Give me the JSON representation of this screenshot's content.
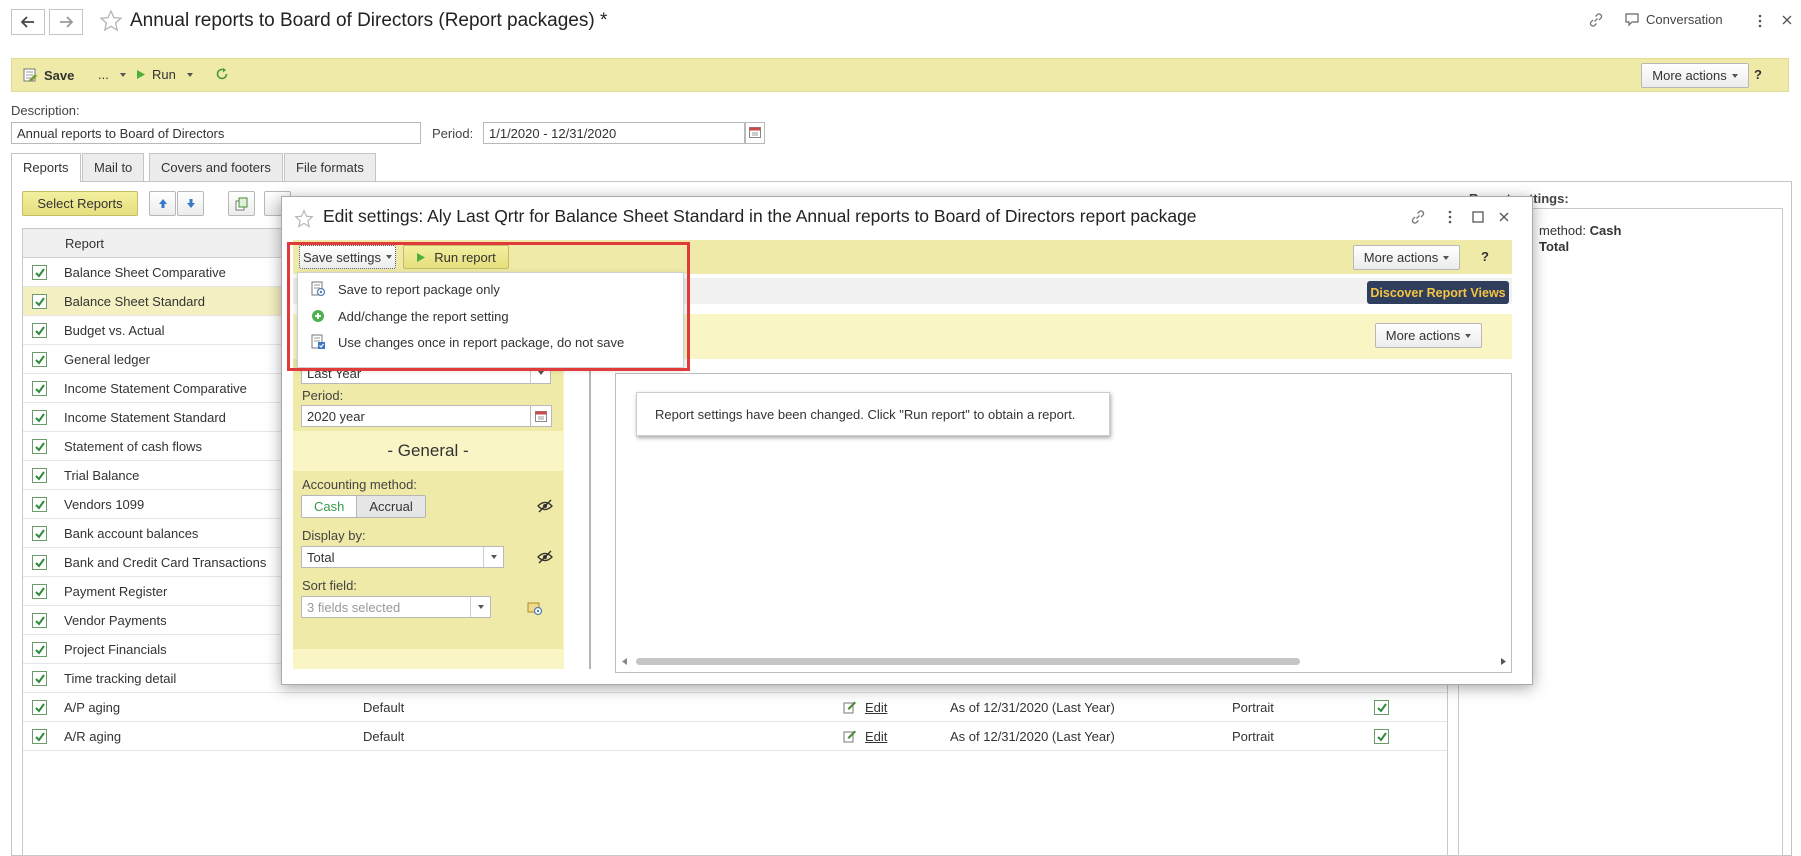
{
  "window": {
    "title": "Annual reports to Board of Directors (Report packages) *",
    "conversation_label": "Conversation"
  },
  "toolbar": {
    "save_label": "Save",
    "dots_label": "...",
    "run_label": "Run",
    "more_actions_label": "More actions",
    "help_label": "?"
  },
  "form": {
    "description_label": "Description:",
    "description_value": "Annual reports to Board of Directors",
    "period_label": "Period:",
    "period_value": "1/1/2020 - 12/31/2020"
  },
  "tabs": [
    {
      "label": "Reports",
      "active": true
    },
    {
      "label": "Mail to",
      "active": false
    },
    {
      "label": "Covers and footers",
      "active": false
    },
    {
      "label": "File formats",
      "active": false
    }
  ],
  "reports_panel": {
    "select_reports_label": "Select Reports",
    "column_report": "Report",
    "rows": [
      {
        "name": "Balance Sheet Comparative",
        "checked": true,
        "selected": false
      },
      {
        "name": "Balance Sheet Standard",
        "checked": true,
        "selected": true
      },
      {
        "name": "Budget vs. Actual",
        "checked": true,
        "selected": false
      },
      {
        "name": "General ledger",
        "checked": true,
        "selected": false
      },
      {
        "name": "Income Statement Comparative",
        "checked": true,
        "selected": false
      },
      {
        "name": "Income Statement Standard",
        "checked": true,
        "selected": false
      },
      {
        "name": "Statement of cash flows",
        "checked": true,
        "selected": false
      },
      {
        "name": "Trial Balance",
        "checked": true,
        "selected": false
      },
      {
        "name": "Vendors 1099",
        "checked": true,
        "selected": false
      },
      {
        "name": "Bank account balances",
        "checked": true,
        "selected": false
      },
      {
        "name": "Bank and Credit Card Transactions",
        "checked": true,
        "selected": false
      },
      {
        "name": "Payment Register",
        "checked": true,
        "selected": false
      },
      {
        "name": "Vendor Payments",
        "checked": true,
        "selected": false
      },
      {
        "name": "Project Financials",
        "checked": true,
        "selected": false
      },
      {
        "name": "Time tracking detail",
        "checked": true,
        "selected": false
      },
      {
        "name": "A/P aging",
        "checked": true,
        "selected": false,
        "variant": "Default",
        "edit": "Edit",
        "period": "As of 12/31/2020 (Last Year)",
        "orientation": "Portrait",
        "include": true
      },
      {
        "name": "A/R aging",
        "checked": true,
        "selected": false,
        "variant": "Default",
        "edit": "Edit",
        "period": "As of 12/31/2020 (Last Year)",
        "orientation": "Portrait",
        "include": true
      }
    ]
  },
  "right_panel": {
    "title_fragment": "Report settings:",
    "method_label": "method:",
    "method_value": "Cash",
    "total_label": "Total"
  },
  "dialog": {
    "title": "Edit settings: Aly Last Qrtr for Balance Sheet Standard in the Annual reports to Board of Directors report package",
    "save_settings_label": "Save settings",
    "run_report_label": "Run report",
    "more_actions_label": "More actions",
    "more_actions_label_2": "More actions",
    "help_label": "?",
    "discover_label": "Discover Report Views",
    "dropdown_items": [
      {
        "label": "Save to report package only",
        "icon": "package-settings-icon"
      },
      {
        "label": "Add/change the report setting",
        "icon": "add-circle-icon"
      },
      {
        "label": "Use changes once in report package, do not save",
        "icon": "package-apply-icon"
      }
    ],
    "settings": {
      "period_type_value": "Last Year",
      "period_label": "Period:",
      "period_value": "2020 year",
      "general_header": "- General -",
      "accounting_method_label": "Accounting method:",
      "cash_label": "Cash",
      "accrual_label": "Accrual",
      "accounting_method_selected": "Cash",
      "display_by_label": "Display by:",
      "display_by_value": "Total",
      "sort_field_label": "Sort field:",
      "sort_field_placeholder": "3 fields selected"
    },
    "message": "Report settings have been changed. Click \"Run report\" to obtain a report."
  }
}
